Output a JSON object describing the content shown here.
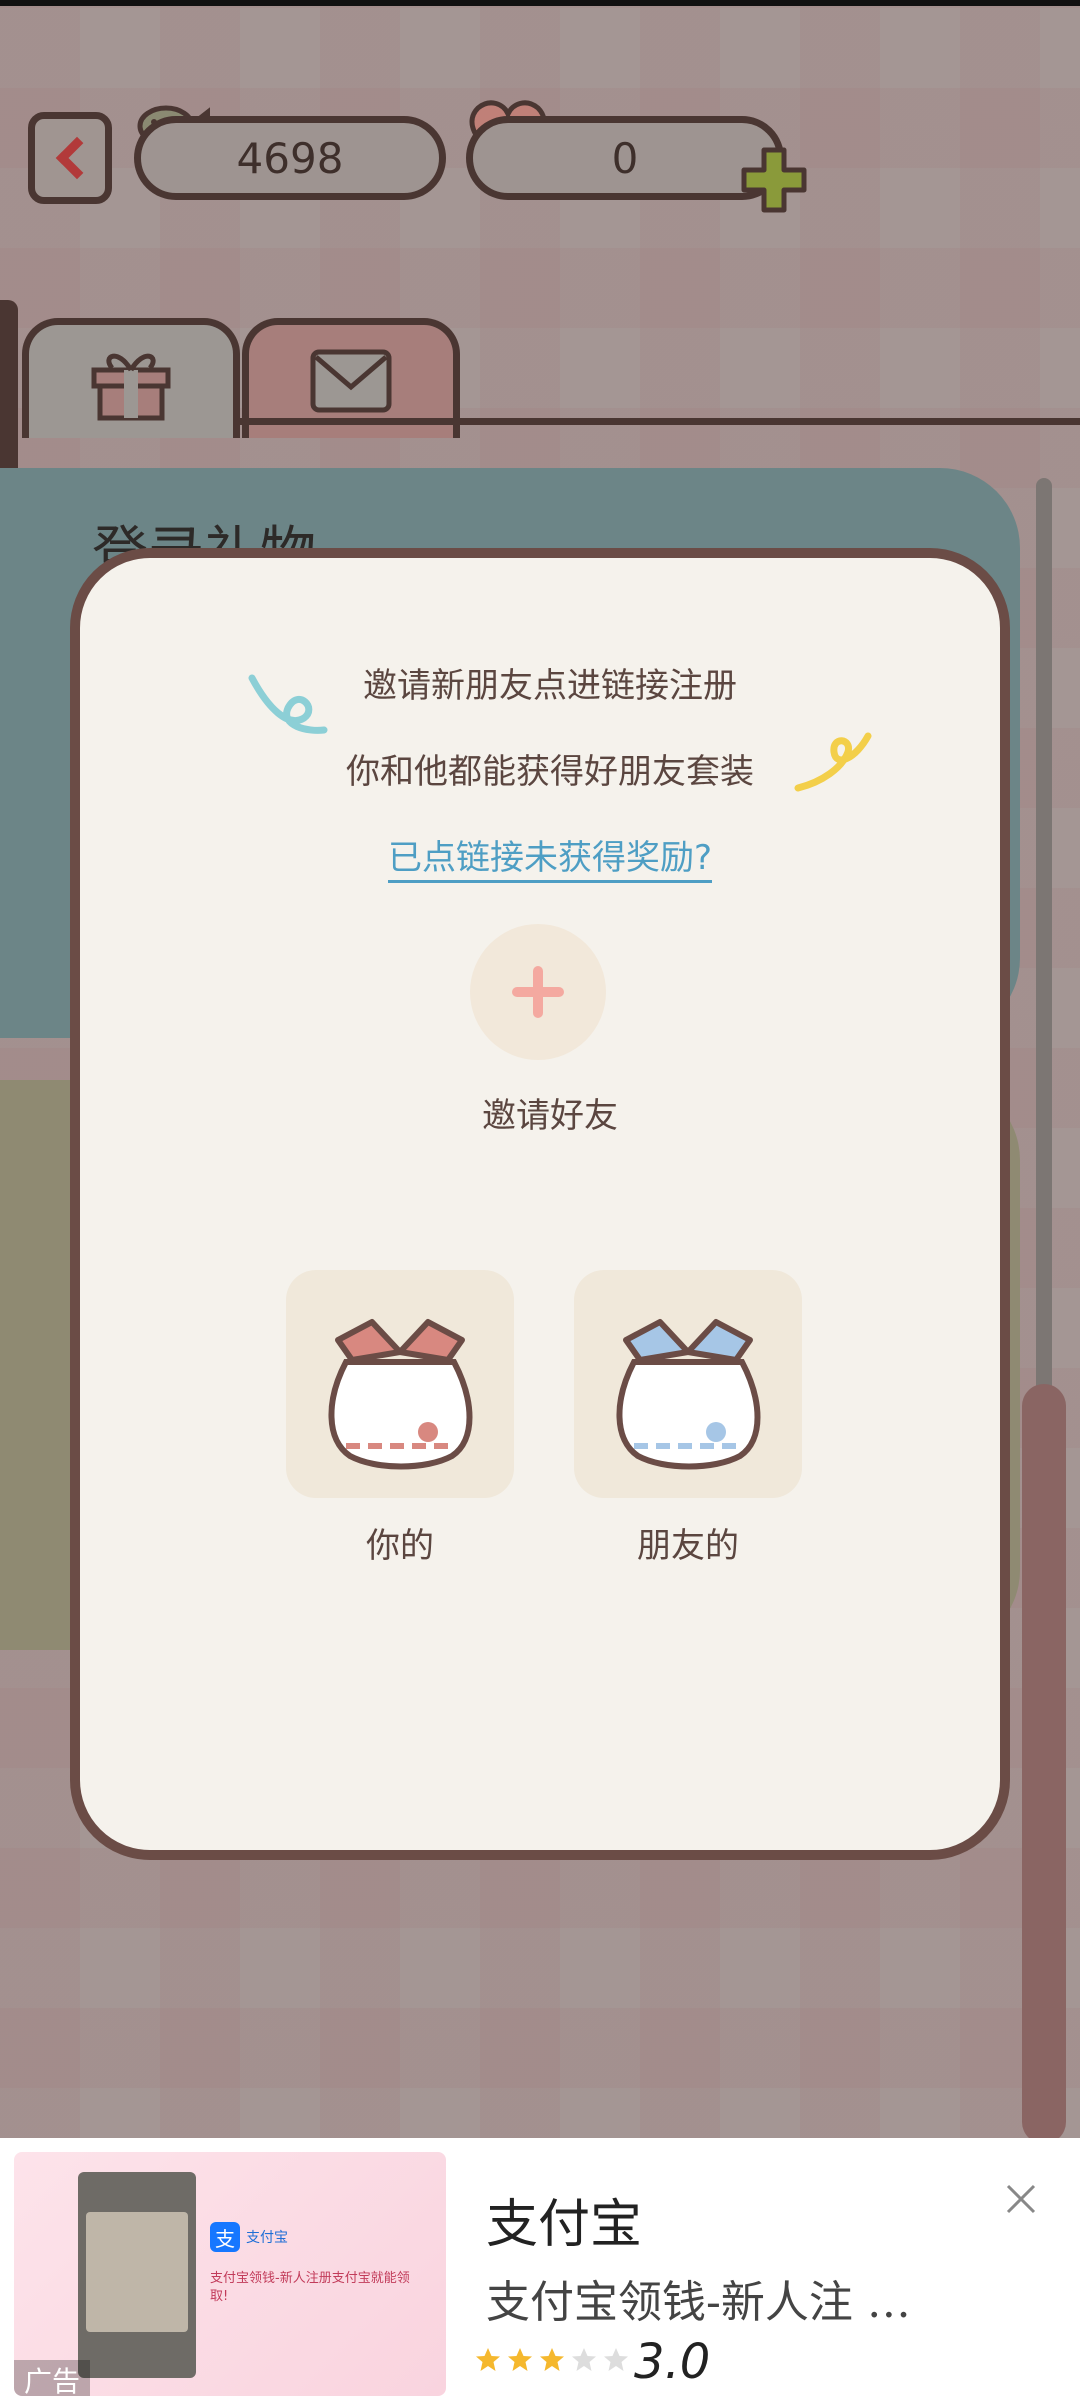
{
  "header": {
    "fish_count": "4698",
    "heart_count": "0"
  },
  "tabs": [
    "gift",
    "mail"
  ],
  "background_card": {
    "title": "登录礼物"
  },
  "modal": {
    "line1": "邀请新朋友点进链接注册",
    "line2": "你和他都能获得好朋友套装",
    "help_link": "已点链接未获得奖励?",
    "invite_label": "邀请好友",
    "mine_label": "你的",
    "friend_label": "朋友的"
  },
  "ad": {
    "title": "支付宝",
    "description": "支付宝领钱-新人注 …",
    "tag": "广告",
    "image_brand": "支付宝",
    "image_text": "支付宝领钱-新人注册支付宝就能领取!",
    "rating": "3.0",
    "stars_filled": 3,
    "stars_total": 5
  },
  "colors": {
    "accent_pink": "#f4a9a0",
    "link_blue": "#4e9ec4",
    "border_brown": "#6b4c46"
  }
}
